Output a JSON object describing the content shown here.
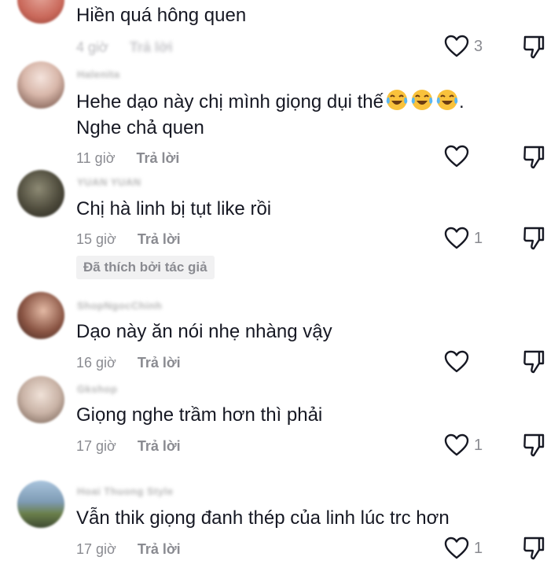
{
  "colors": {
    "text": "#161823",
    "secondary": "#8a8b91",
    "badge_bg": "#f1f1f2"
  },
  "comments": [
    {
      "avatar_color": "#c9685a",
      "username": "",
      "text": "Hiền quá hông quen",
      "time": "4 giờ",
      "reply": "Trả lời",
      "likes": "3",
      "icons": [
        "heart-outline-icon",
        "dislike-icon"
      ]
    },
    {
      "avatar_color": "#b9978c",
      "username": "Halenita",
      "text_line1": "Hehe dạo này chị mình giọng dụi thế",
      "emoji": [
        "face-with-tears-of-joy-icon",
        "face-with-tears-of-joy-icon",
        "face-with-tears-of-joy-icon"
      ],
      "text_after_emoji": ".",
      "text_line2": "Nghe chả quen",
      "time": "11 giờ",
      "reply": "Trả lời",
      "likes": ""
    },
    {
      "avatar_color": "#4e4b3c",
      "username": "YUAN YUAN",
      "text": "Chị hà linh bị tụt like rồi",
      "time": "15 giờ",
      "reply": "Trả lời",
      "likes": "1",
      "badge": "Đã thích bởi tác giả"
    },
    {
      "avatar_color": "#8a5544",
      "username": "ShopNgocChinh",
      "text": "Dạo này ăn nói nhẹ nhàng vậy",
      "time": "16 giờ",
      "reply": "Trả lời",
      "likes": ""
    },
    {
      "avatar_color": "#c9b3a6",
      "username": "Gkshop",
      "text": "Giọng nghe trầm hơn thì phải",
      "time": "17 giờ",
      "reply": "Trả lời",
      "likes": "1"
    },
    {
      "avatar_color": "#7e9bb4",
      "username": "Hoai Thuong Style",
      "text": "Vẫn thik giọng đanh thép của linh lúc trc hơn",
      "time": "17 giờ",
      "reply": "Trả lời",
      "likes": "1"
    }
  ]
}
